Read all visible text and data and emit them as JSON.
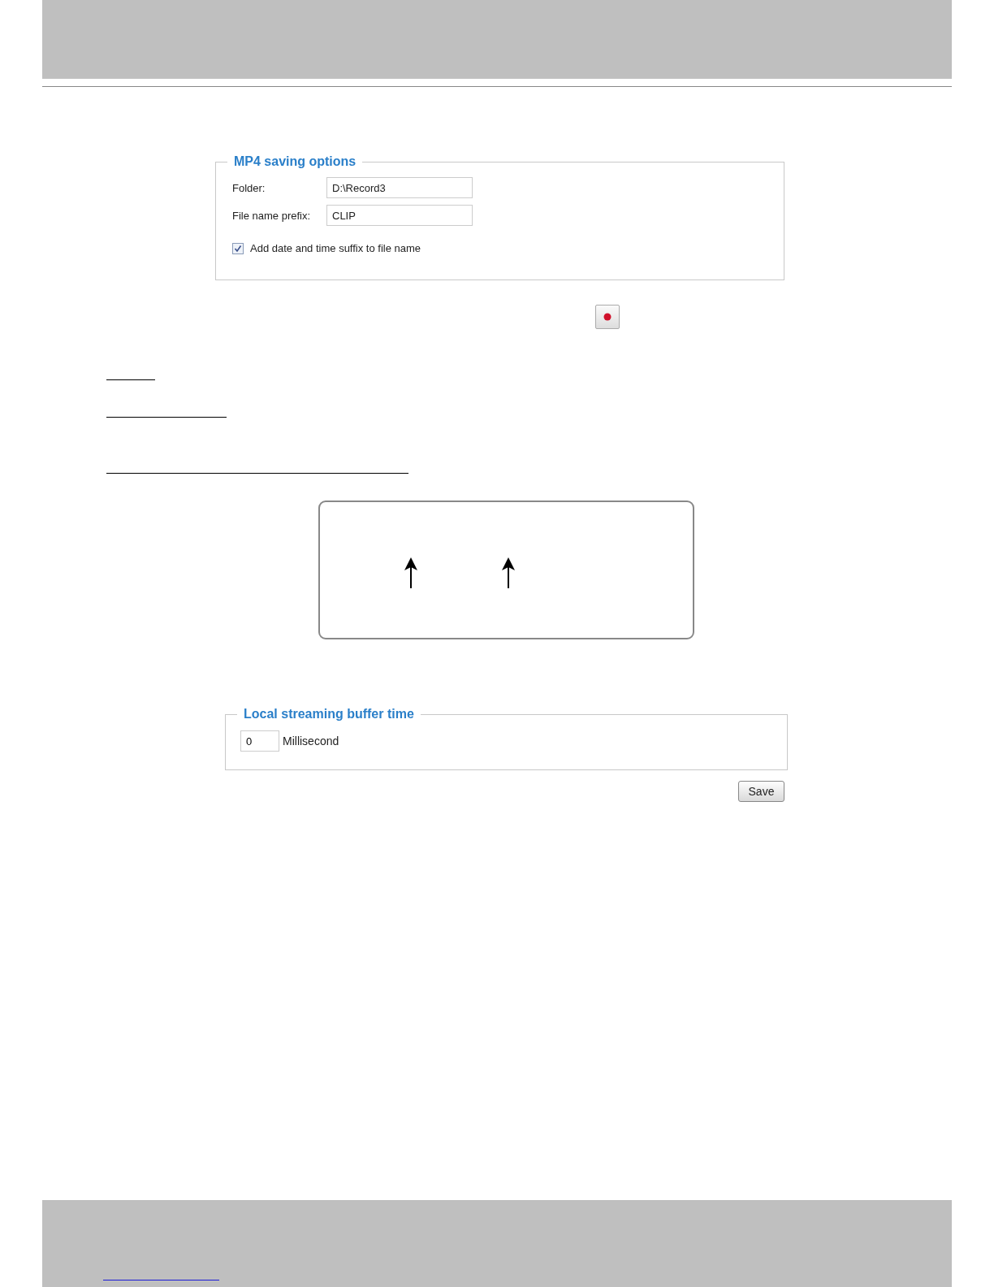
{
  "mp4_saving_options": {
    "title": "MP4 saving options",
    "fields": [
      {
        "label": "Folder:",
        "value": "D:\\Record3"
      },
      {
        "label": "File name prefix:",
        "value": "CLIP"
      }
    ],
    "suffix_checkbox": {
      "label": "Add date and time suffix to file name",
      "checked": true
    }
  },
  "local_streaming_buffer": {
    "title": "Local streaming buffer time",
    "value": "0",
    "unit": "Millisecond"
  },
  "save_button": "Save"
}
